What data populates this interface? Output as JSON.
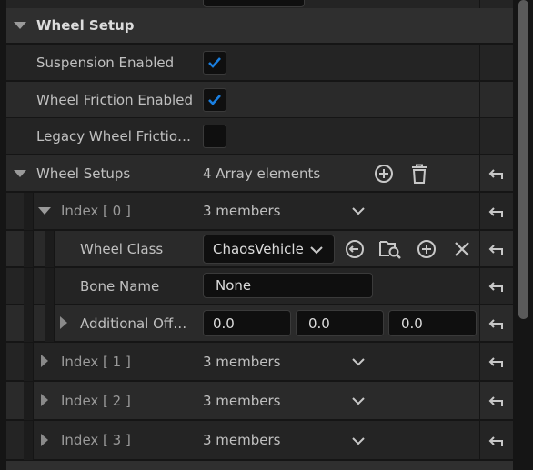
{
  "header": {
    "title": "Wheel Setup"
  },
  "props": {
    "suspension": {
      "label": "Suspension Enabled",
      "checked": true
    },
    "friction": {
      "label": "Wheel Friction Enabled",
      "checked": true
    },
    "legacy": {
      "label": "Legacy Wheel Frictio…",
      "checked": false
    }
  },
  "wheel_setups": {
    "label": "Wheel Setups",
    "count": "4 Array elements",
    "items": [
      {
        "label": "Index [ 0 ]",
        "members": "3 members"
      },
      {
        "label": "Index [ 1 ]",
        "members": "3 members"
      },
      {
        "label": "Index [ 2 ]",
        "members": "3 members"
      },
      {
        "label": "Index [ 3 ]",
        "members": "3 members"
      }
    ]
  },
  "index0": {
    "wheel_class": {
      "label": "Wheel Class",
      "value": "ChaosVehicle"
    },
    "bone_name": {
      "label": "Bone Name",
      "value": "None"
    },
    "offset": {
      "label": "Additional Off…",
      "x": "0.0",
      "y": "0.0",
      "z": "0.0"
    }
  },
  "colors": {
    "accent": "#1a7fe0",
    "bg": "#242424",
    "header": "#2f2f2f"
  },
  "icons": [
    "collapse-arrow-icon",
    "checkmark-icon",
    "add-icon",
    "trash-icon",
    "reset-icon",
    "chevron-down-icon",
    "use-selected-icon",
    "browse-icon",
    "clear-icon"
  ]
}
